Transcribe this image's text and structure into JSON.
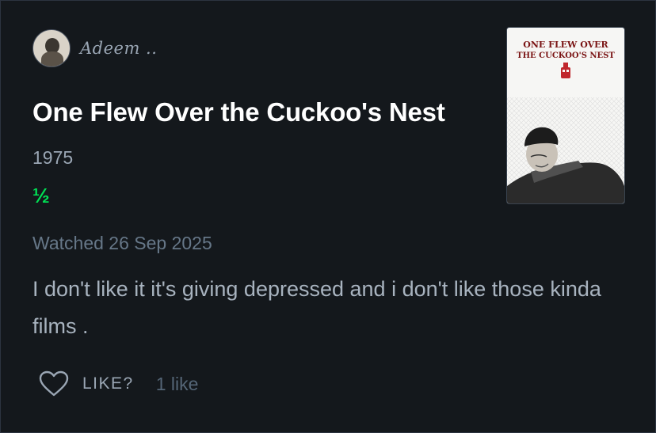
{
  "author": {
    "name": "Adeem ..",
    "avatar_icon": "user-avatar"
  },
  "film": {
    "title": "One Flew Over the Cuckoo's Nest",
    "year": "1975",
    "rating": "½",
    "poster_title_line1": "ONE FLEW OVER",
    "poster_title_line2": "THE CUCKOO'S NEST"
  },
  "entry": {
    "watched": "Watched 26 Sep 2025",
    "review": "I don't like it it's giving depressed and i don't like those kinda films ."
  },
  "actions": {
    "like_label": "LIKE?",
    "like_count": "1 like",
    "heart_icon": "heart-icon"
  },
  "colors": {
    "background": "#14181c",
    "rating_green": "#00e054",
    "muted_text": "#9aa6b4"
  }
}
